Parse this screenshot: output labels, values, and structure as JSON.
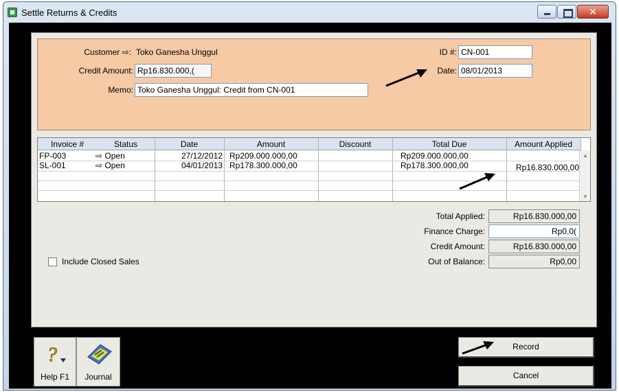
{
  "window": {
    "title": "Settle Returns & Credits"
  },
  "header": {
    "customer_label": "Customer",
    "customer_arrow": "⇨:",
    "customer_value": "Toko Ganesha Unggul",
    "credit_amount_label": "Credit Amount:",
    "credit_amount_value": "Rp16.830.000,(",
    "memo_label": "Memo:",
    "memo_value": "Toko Ganesha Unggul:  Credit from CN-001",
    "id_label": "ID #:",
    "id_value": "CN-001",
    "date_label": "Date:",
    "date_value": "08/01/2013"
  },
  "grid": {
    "columns": [
      "Invoice #",
      "Status",
      "Date",
      "Amount",
      "Discount",
      "Total Due",
      "Amount Applied"
    ],
    "rows": [
      {
        "invoice": "FP-003",
        "status": "⇨ Open",
        "date": "27/12/2012",
        "amount": "Rp209.000.000,00",
        "discount": "",
        "total_due": "Rp209.000.000,00",
        "applied": ""
      },
      {
        "invoice": "SL-001",
        "status": "⇨ Open",
        "date": "04/01/2013",
        "amount": "Rp178.300.000,00",
        "discount": "",
        "total_due": "Rp178.300.000,00",
        "applied": "Rp16.830.000,00"
      }
    ]
  },
  "totals": {
    "total_applied_label": "Total Applied:",
    "total_applied_value": "Rp16.830.000,00",
    "finance_charge_label": "Finance Charge:",
    "finance_charge_value": "Rp0,0(",
    "credit_amount_label": "Credit Amount:",
    "credit_amount_value": "Rp16.830.000,00",
    "out_of_balance_label": "Out of Balance:",
    "out_of_balance_value": "Rp0,00"
  },
  "options": {
    "include_closed_label": "Include Closed Sales",
    "include_closed_checked": false
  },
  "toolbar": {
    "help_label": "Help F1",
    "journal_label": "Journal",
    "record_label": "Record",
    "cancel_label": "Cancel"
  }
}
